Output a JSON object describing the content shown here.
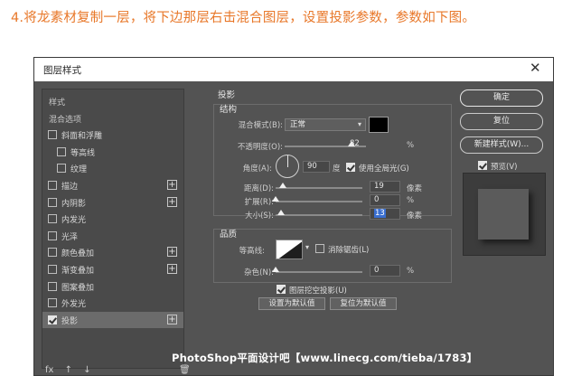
{
  "heading": "4.将龙素材复制一层，将下边那层右击混合图层，设置投影参数，参数如下图。",
  "dialog": {
    "title": "图层样式",
    "close": "✕"
  },
  "styles_list": [
    {
      "label": "样式",
      "kind": "header"
    },
    {
      "label": "混合选项",
      "kind": "header"
    },
    {
      "label": "斜面和浮雕",
      "checked": false,
      "plus": false,
      "indent": 0
    },
    {
      "label": "等高线",
      "checked": false,
      "plus": false,
      "indent": 1
    },
    {
      "label": "纹理",
      "checked": false,
      "plus": false,
      "indent": 1
    },
    {
      "label": "描边",
      "checked": false,
      "plus": true,
      "indent": 0
    },
    {
      "label": "内阴影",
      "checked": false,
      "plus": true,
      "indent": 0
    },
    {
      "label": "内发光",
      "checked": false,
      "plus": false,
      "indent": 0
    },
    {
      "label": "光泽",
      "checked": false,
      "plus": false,
      "indent": 0
    },
    {
      "label": "颜色叠加",
      "checked": false,
      "plus": true,
      "indent": 0
    },
    {
      "label": "渐变叠加",
      "checked": false,
      "plus": true,
      "indent": 0
    },
    {
      "label": "图案叠加",
      "checked": false,
      "plus": false,
      "indent": 0
    },
    {
      "label": "外发光",
      "checked": false,
      "plus": false,
      "indent": 0
    },
    {
      "label": "投影",
      "checked": true,
      "plus": true,
      "indent": 0,
      "selected": true
    }
  ],
  "bottom_icons": [
    "fx",
    "↑",
    "↓"
  ],
  "trash": "🗑",
  "shadow": {
    "section_title": "投影",
    "structure_title": "结构",
    "blend_mode_label": "混合模式(B):",
    "blend_mode_value": "正常",
    "color": "#000000",
    "opacity_label": "不透明度(O):",
    "opacity_value": "82",
    "opacity_unit": "%",
    "angle_label": "角度(A):",
    "angle_value": "90",
    "angle_unit": "度",
    "global_light_label": "使用全局光(G)",
    "global_light_checked": true,
    "distance_label": "距离(D):",
    "distance_value": "19",
    "distance_unit": "像素",
    "spread_label": "扩展(R):",
    "spread_value": "0",
    "spread_unit": "%",
    "size_label": "大小(S):",
    "size_value": "13",
    "size_unit": "像素",
    "quality_title": "品质",
    "contour_label": "等高线:",
    "antialias_label": "消除锯齿(L)",
    "antialias_checked": false,
    "noise_label": "杂色(N):",
    "noise_value": "0",
    "noise_unit": "%",
    "knockout_label": "图层挖空投影(U)",
    "knockout_checked": true,
    "set_default": "设置为默认值",
    "reset_default": "复位为默认值",
    "slider_levels": {
      "opacity": 0.82,
      "distance": 0.08,
      "spread": 0.0,
      "size": 0.06,
      "noise": 0.0
    }
  },
  "right": {
    "ok": "确定",
    "reset": "复位",
    "new_style": "新建样式(W)...",
    "preview_label": "预览(V)",
    "preview_checked": true
  },
  "watermark": "PhotoShop平面设计吧【www.linecg.com/tieba/1783】"
}
